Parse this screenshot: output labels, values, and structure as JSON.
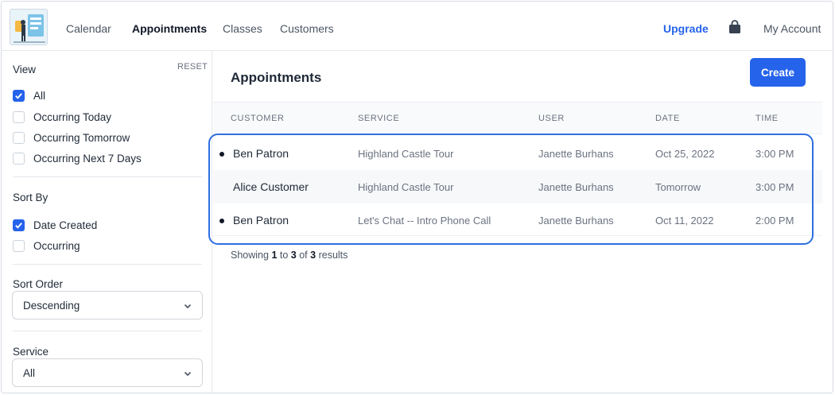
{
  "nav": {
    "items": [
      "Calendar",
      "Appointments",
      "Classes",
      "Customers"
    ],
    "upgrade": "Upgrade",
    "account": "My Account"
  },
  "sidebar": {
    "view_title": "View",
    "reset": "RESET",
    "view_options": [
      {
        "label": "All",
        "checked": true
      },
      {
        "label": "Occurring Today",
        "checked": false
      },
      {
        "label": "Occurring Tomorrow",
        "checked": false
      },
      {
        "label": "Occurring Next 7 Days",
        "checked": false
      }
    ],
    "sort_by_title": "Sort By",
    "sort_by_options": [
      {
        "label": "Date Created",
        "checked": true
      },
      {
        "label": "Occurring",
        "checked": false
      }
    ],
    "sort_order_title": "Sort Order",
    "sort_order_value": "Descending",
    "service_title": "Service",
    "service_value": "All"
  },
  "main": {
    "title": "Appointments",
    "create": "Create",
    "columns": [
      "CUSTOMER",
      "SERVICE",
      "USER",
      "DATE",
      "TIME"
    ],
    "rows": [
      {
        "customer": "Ben Patron",
        "service": "Highland Castle Tour",
        "user": "Janette Burhans",
        "date": "Oct 25, 2022",
        "time": "3:00 PM",
        "dot": true
      },
      {
        "customer": "Alice Customer",
        "service": "Highland Castle Tour",
        "user": "Janette Burhans",
        "date": "Tomorrow",
        "time": "3:00 PM",
        "dot": false
      },
      {
        "customer": "Ben Patron",
        "service": "Let's Chat -- Intro Phone Call",
        "user": "Janette Burhans",
        "date": "Oct 11, 2022",
        "time": "2:00 PM",
        "dot": true
      }
    ],
    "showing": {
      "prefix": "Showing",
      "from": "1",
      "to_word": "to",
      "to": "3",
      "of_word": "of",
      "total": "3",
      "suffix": "results"
    }
  },
  "colors": {
    "accent": "#2563eb",
    "highlight": "#2f6fe0"
  },
  "icons": {
    "logo": "app-logo",
    "bag": "shopping-bag-icon",
    "check": "check-icon",
    "chevron": "chevron-down-icon"
  }
}
